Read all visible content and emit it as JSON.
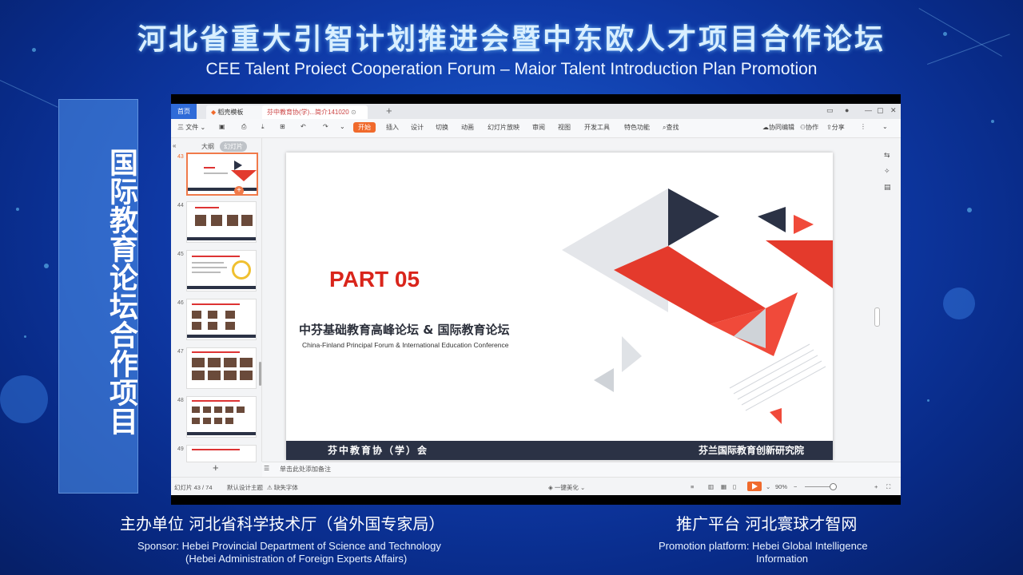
{
  "banner": {
    "title_cn": "河北省重大引智计划推进会暨中东欧人才项目合作论坛",
    "title_en": "CEE Talent Proiect Cooperation Forum – Maior Talent Introduction Plan Promotion"
  },
  "side_panel": {
    "text": "国际教育论坛合作项目"
  },
  "wps": {
    "tabs": {
      "home": "首页",
      "template": "稻壳模板",
      "doc": "芬中教育协(学)...简介141020"
    },
    "toolbar": {
      "file": "三 文件 ⌄",
      "start": "开始",
      "insert": "插入",
      "design": "设计",
      "transition": "切换",
      "animation": "动画",
      "slideshow": "幻灯片放映",
      "review": "审阅",
      "view": "视图",
      "dev": "开发工具",
      "special": "特色功能",
      "search": "查找",
      "collab_edit": "协同编辑",
      "collab": "协作",
      "share": "分享"
    },
    "left_pane": {
      "outline": "大纲",
      "slides": "幻灯片",
      "slide_numbers": [
        "43",
        "44",
        "45",
        "46",
        "47",
        "48",
        "49"
      ],
      "add": "+"
    },
    "slide": {
      "part": "PART 05",
      "title_cn": "中芬基础教育高峰论坛 & 国际教育论坛",
      "title_en": "China-Finland Principal Forum & International Education Conference",
      "footer_left": "芬中教育协（学）会",
      "footer_right": "芬兰国际教育创新研究院"
    },
    "notes_placeholder": "单击此处添加备注",
    "status": {
      "slide_count": "幻灯片 43 / 74",
      "theme": "默认设计主题",
      "font_missing": "缺失字体",
      "beautify": "一键美化 ⌄",
      "zoom": "90%"
    }
  },
  "footer": {
    "sponsor_cn": "主办单位  河北省科学技术厅（省外国专家局）",
    "sponsor_en1": "Sponsor: Hebei Provincial Department of Science and Technology",
    "sponsor_en2": "(Hebei Administration of Foreign Experts Affairs)",
    "platform_cn": "推广平台  河北寰球才智网",
    "platform_en1": "Promotion platform:   Hebei Global Intelligence",
    "platform_en2": "Information"
  },
  "colors": {
    "accent": "#f06a2c",
    "brand_red": "#d9251b",
    "dark_navy": "#2b3245",
    "bg_blue": "#0f3aa8"
  }
}
